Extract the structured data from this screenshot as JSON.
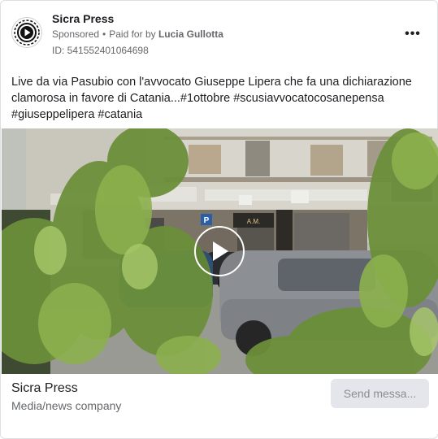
{
  "ad": {
    "page_name": "Sicra Press",
    "sponsored_label": "Sponsored",
    "separator": "•",
    "paid_for_prefix": "Paid for by",
    "paid_for_name": "Lucia Gullotta",
    "ad_id": "ID: 541552401064698",
    "more_icon": "more-horizontal-icon",
    "more_glyph": "•••",
    "body_text": "Live da via Pasubio con l'avvocato Giuseppe Lipera che fa una dichiarazione clamorosa in favore di Catania...#1ottobre #scusiavvocatocosanepensa #giuseppelipera #catania"
  },
  "media": {
    "type": "video",
    "play_icon": "play-icon",
    "storefront_sign": "A.M."
  },
  "footer": {
    "name": "Sicra Press",
    "category": "Media/news company",
    "cta_label": "Send messa..."
  },
  "colors": {
    "text_primary": "#1c1e21",
    "text_secondary": "#65676b",
    "cta_bg": "#e4e6eb",
    "cta_text": "#8a8d91",
    "border": "#dddfe2"
  }
}
